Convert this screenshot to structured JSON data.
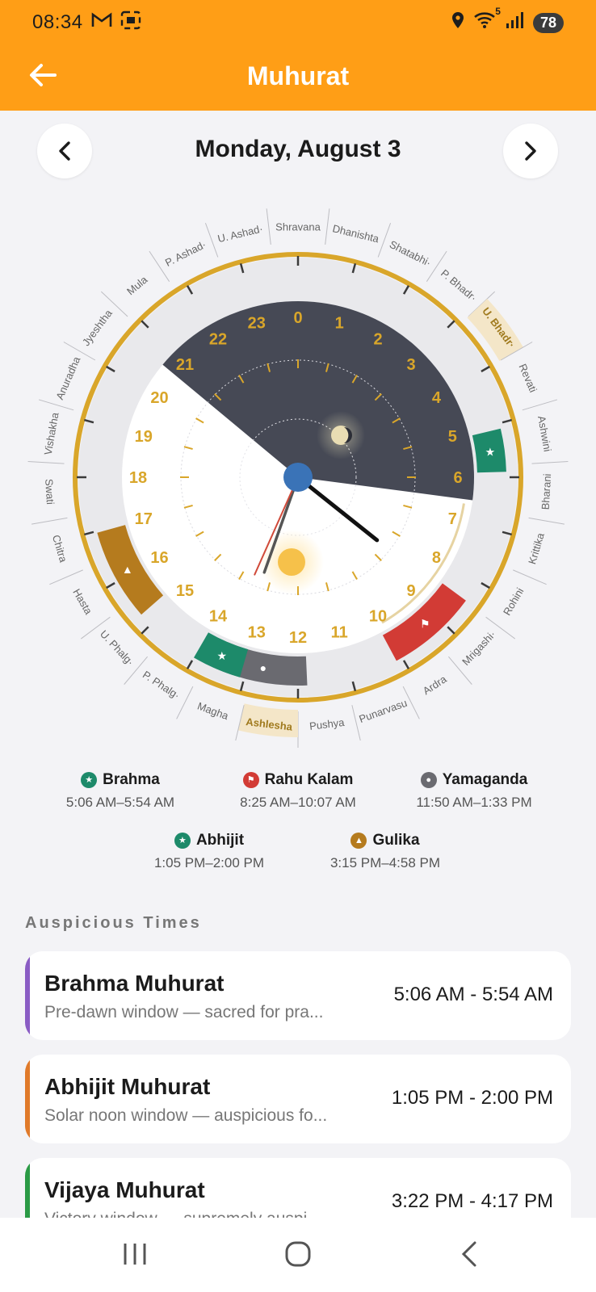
{
  "status_bar": {
    "time": "08:34",
    "left_icons": [
      "gmail-icon",
      "screenshot-icon"
    ],
    "right_icons": [
      "location-icon",
      "wifi-icon",
      "signal-icon"
    ],
    "wifi_badge": "5",
    "battery": "78"
  },
  "header": {
    "title": "Muhurat",
    "accent": "#ff9e16"
  },
  "date_nav": {
    "date": "Monday, August 3"
  },
  "clock": {
    "hours": [
      "0",
      "1",
      "2",
      "3",
      "4",
      "5",
      "6",
      "7",
      "8",
      "9",
      "10",
      "11",
      "12",
      "13",
      "14",
      "15",
      "16",
      "17",
      "18",
      "19",
      "20",
      "21",
      "22",
      "23"
    ],
    "night_color": "#464955",
    "gold": "#d9a62a",
    "nakshatras": [
      "Shravana",
      "Dhanishta",
      "Shatabhi·",
      "P. Bhadr·",
      "U. Bhadr·",
      "Revati",
      "Ashwini",
      "Bharani",
      "Krittika",
      "Rohini",
      "Mrigashi·",
      "Ardra",
      "Punarvasu",
      "Pushya",
      "Ashlesha",
      "Magha",
      "P. Phalg·",
      "U. Phalg·",
      "Hasta",
      "Chitra",
      "Swati",
      "Vishakha",
      "Anuradha",
      "Jyeshtha",
      "Mula",
      "P. Ashad·",
      "U. Ashad·"
    ],
    "highlighted_nakshatras": [
      "U. Bhadr·",
      "Ashlesha"
    ]
  },
  "legend": [
    {
      "name": "Brahma",
      "time": "5:06 AM–5:54 AM",
      "icon": "star-icon",
      "color": "#1d8a6a"
    },
    {
      "name": "Rahu Kalam",
      "time": "8:25 AM–10:07 AM",
      "icon": "flag-icon",
      "color": "#d23b35"
    },
    {
      "name": "Yamaganda",
      "time": "11:50 AM–1:33 PM",
      "icon": "dot-icon",
      "color": "#6a6a70"
    },
    {
      "name": "Abhijit",
      "time": "1:05 PM–2:00 PM",
      "icon": "star-icon",
      "color": "#1d8a6a"
    },
    {
      "name": "Gulika",
      "time": "3:15 PM–4:58 PM",
      "icon": "triangle-icon",
      "color": "#b57b1e"
    }
  ],
  "auspicious": {
    "title": "Auspicious Times",
    "items": [
      {
        "name": "Brahma Muhurat",
        "desc": "Pre-dawn window — sacred for pra...",
        "time": "5:06 AM - 5:54 AM",
        "color": "#8a5cc4"
      },
      {
        "name": "Abhijit Muhurat",
        "desc": "Solar noon window — auspicious fo...",
        "time": "1:05 PM - 2:00 PM",
        "color": "#e07a2a"
      },
      {
        "name": "Vijaya Muhurat",
        "desc": "Victory window — supremely auspi...",
        "time": "3:22 PM - 4:17 PM",
        "color": "#2a9a45"
      }
    ]
  }
}
